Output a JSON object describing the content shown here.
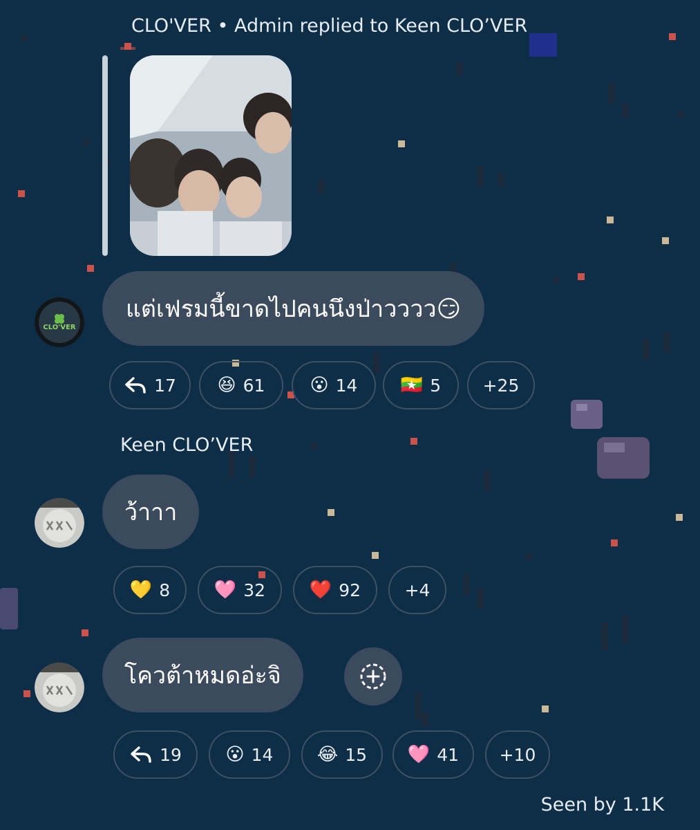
{
  "reply_header": "CLO'VER • Admin replied to Keen CLO’VER",
  "messages": [
    {
      "id": "msg1",
      "avatar": "clover-logo-avatar",
      "avatar_text": "CLO'VER",
      "text": "แต่เฟรมนี้ขาดไปคนนึงป่าวววว😏",
      "reactions": [
        {
          "kind": "reply",
          "icon": "reply-arrow-icon",
          "count": "17"
        },
        {
          "kind": "emoji",
          "emoji": "😆",
          "count": "61"
        },
        {
          "kind": "emoji",
          "emoji": "😮",
          "count": "14"
        },
        {
          "kind": "emoji",
          "emoji": "🇲🇲",
          "count": "5"
        },
        {
          "kind": "more",
          "count": "+25"
        }
      ]
    },
    {
      "id": "msg2",
      "sender": "Keen CLO’VER",
      "avatar": "keen-avatar",
      "text": "ว้าาา",
      "reactions": [
        {
          "kind": "emoji",
          "emoji": "💛",
          "count": "8"
        },
        {
          "kind": "emoji",
          "emoji": "🩷",
          "count": "32"
        },
        {
          "kind": "emoji",
          "emoji": "❤️",
          "count": "92"
        },
        {
          "kind": "more",
          "count": "+4"
        }
      ]
    },
    {
      "id": "msg3",
      "avatar": "keen-avatar",
      "text": "โควต้าหมดอ่ะจิ",
      "reactions": [
        {
          "kind": "reply",
          "icon": "reply-arrow-icon",
          "count": "19"
        },
        {
          "kind": "emoji",
          "emoji": "😮",
          "count": "14"
        },
        {
          "kind": "emoji",
          "emoji": "😂",
          "count": "15"
        },
        {
          "kind": "emoji",
          "emoji": "🩷",
          "count": "41"
        },
        {
          "kind": "more",
          "count": "+10"
        }
      ]
    }
  ],
  "seen_by": "Seen by 1.1K",
  "colors": {
    "background": "#0e2e47",
    "bubble": "#3c4a5e",
    "chip_border": "#3d5166",
    "text": "#ffffff"
  }
}
